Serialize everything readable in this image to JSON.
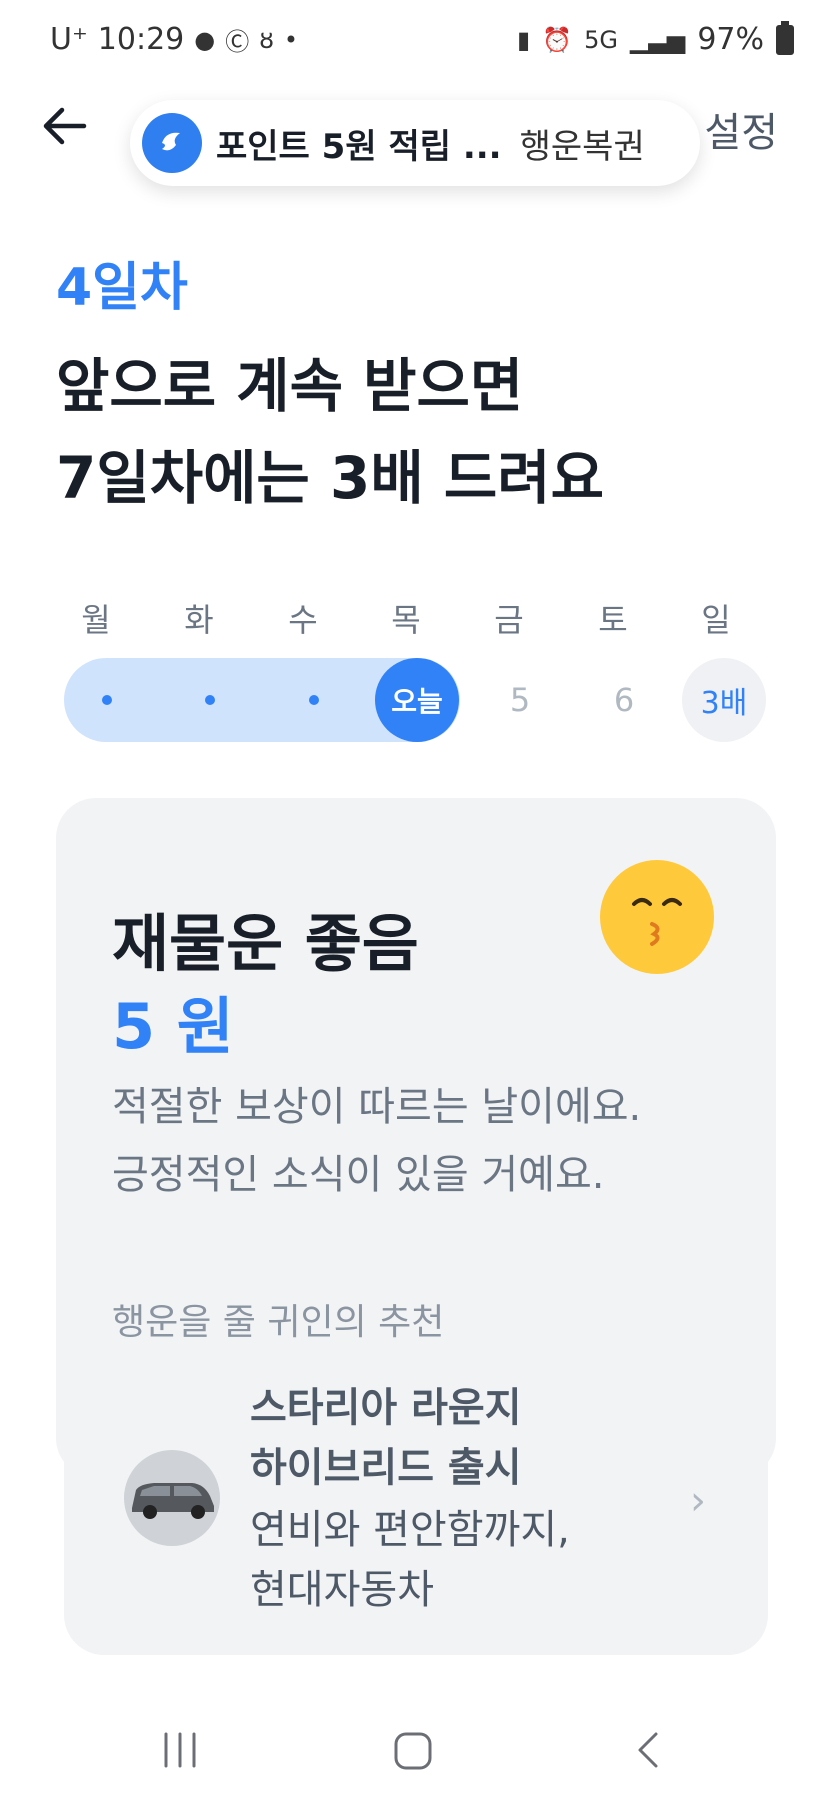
{
  "status_bar": {
    "carrier": "U⁺",
    "time": "10:29",
    "battery": "97%"
  },
  "header": {
    "notice_title": "포인트 5원 적립 ...",
    "notice_sub": "행운복권",
    "settings_label": "설정"
  },
  "intro": {
    "day_label": "4일차",
    "headline_line1": "앞으로 계속 받으면",
    "headline_line2": "7일차에는 3배 드려요"
  },
  "week": {
    "days": [
      "월",
      "화",
      "수",
      "목",
      "금",
      "토",
      "일"
    ],
    "today_label": "오늘",
    "future": [
      "5",
      "6"
    ],
    "bonus_label": "3배"
  },
  "fortune": {
    "title": "재물운 좋음",
    "amount": "5 원",
    "desc_line1": "적절한 보상이 따르는 날이에요.",
    "desc_line2": "긍정적인 소식이 있을 거예요.",
    "sponsor_label": "행운을 줄 귀인의 추천"
  },
  "ad": {
    "title_line1": "스타리아 라운지",
    "title_line2": "하이브리드 출시",
    "desc_line1": "연비와 편안함까지,",
    "desc_line2": "현대자동차"
  },
  "colors": {
    "accent": "#3182f6",
    "track": "#cfe3fd",
    "card_bg": "#f2f3f5",
    "emoji": "#ffc93c"
  }
}
